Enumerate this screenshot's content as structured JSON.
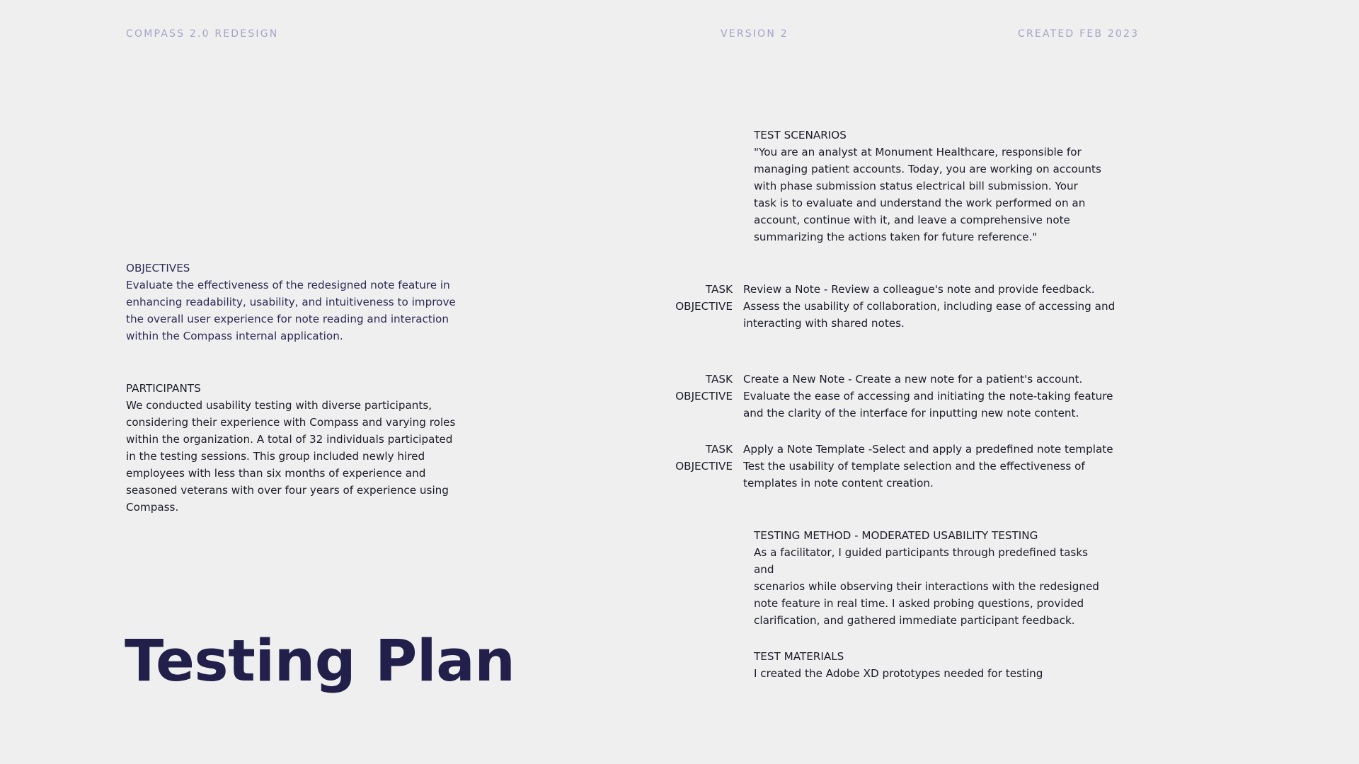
{
  "header": {
    "project": "COMPASS 2.0 REDESIGN",
    "version": "VERSION 2",
    "created": "CREATED FEB 2023"
  },
  "title": "Testing Plan",
  "objectives": {
    "heading": "OBJECTIVES",
    "body": "Evaluate the effectiveness of the redesigned note feature in\nenhancing readability, usability, and intuitiveness to improve\nthe overall user experience for note reading and interaction\nwithin the Compass internal application."
  },
  "participants": {
    "heading": "PARTICIPANTS",
    "body": "We conducted usability testing with diverse participants,\nconsidering their experience with Compass and varying roles\nwithin the organization. A total of 32 individuals participated\nin the testing sessions. This group included newly hired\nemployees with less than six months of experience and\nseasoned veterans with over four years of experience using\nCompass."
  },
  "scenarios": {
    "heading": "TEST SCENARIOS",
    "body": "\"You are an analyst at Monument Healthcare, responsible for\nmanaging patient accounts. Today, you are working on accounts\nwith phase submission status electrical bill submission. Your\ntask is to evaluate and understand the work performed on an\naccount, continue with it, and leave a comprehensive note\nsummarizing the actions taken for future reference.\""
  },
  "tasks": [
    {
      "task_label": "TASK",
      "objective_label": "OBJECTIVE",
      "task": "Review a Note - Review a colleague's note and provide feedback.",
      "objective": "Assess the usability of collaboration, including ease of accessing and\ninteracting with shared notes."
    },
    {
      "task_label": "TASK",
      "objective_label": "OBJECTIVE",
      "task": "Create a New Note  - Create a new note for a patient's account.",
      "objective": "Evaluate the ease of accessing and initiating the note-taking feature\nand the clarity of the interface for inputting new note content."
    },
    {
      "task_label": "TASK",
      "objective_label": "OBJECTIVE",
      "task": "Apply a Note Template -Select and apply a predefined note template",
      "objective": "Test the usability of template selection and the effectiveness of\ntemplates in note content creation."
    }
  ],
  "method": {
    "heading": "TESTING METHOD - MODERATED USABILITY TESTING",
    "body": "As a facilitator, I guided participants through predefined tasks and\nscenarios while observing their interactions with the redesigned\nnote feature in real time. I asked probing questions, provided\nclarification, and gathered immediate participant feedback."
  },
  "materials": {
    "heading": "TEST MATERIALS",
    "body": "I created the Adobe XD prototypes needed for testing"
  }
}
